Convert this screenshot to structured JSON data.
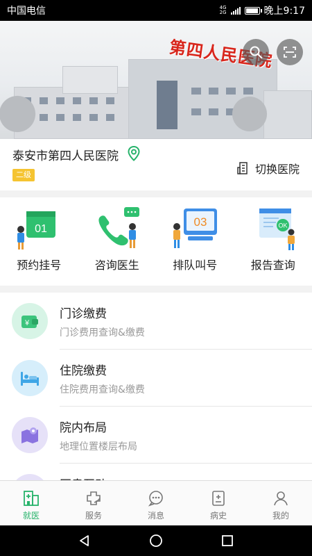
{
  "status_bar": {
    "carrier": "中国电信",
    "net_top": "4G",
    "net_bottom": "2G",
    "time": "晚上9:17",
    "battery_level": 0.85
  },
  "hero": {
    "sign_text": "第四人民医院"
  },
  "hospital": {
    "name": "泰安市第四人民医院",
    "level": "二级",
    "switch_label": "切换医院"
  },
  "actions": [
    {
      "label": "预约挂号",
      "badge": "01"
    },
    {
      "label": "咨询医生"
    },
    {
      "label": "排队叫号",
      "badge": "03"
    },
    {
      "label": "报告查询",
      "badge": "OK"
    }
  ],
  "list": [
    {
      "title": "门诊缴费",
      "subtitle": "门诊费用查询&缴费",
      "color": "#d7f4e6"
    },
    {
      "title": "住院缴费",
      "subtitle": "住院费用查询&缴费",
      "color": "#d6eefb"
    },
    {
      "title": "院内布局",
      "subtitle": "地理位置楼层布局",
      "color": "#e6e1f8"
    },
    {
      "title": "医患互动",
      "color": "#e6e1f8"
    }
  ],
  "tabs": [
    {
      "label": "就医",
      "active": true
    },
    {
      "label": "服务"
    },
    {
      "label": "消息"
    },
    {
      "label": "病史"
    },
    {
      "label": "我的"
    }
  ],
  "colors": {
    "accent": "#27b36b",
    "badge": "#f5c431"
  }
}
